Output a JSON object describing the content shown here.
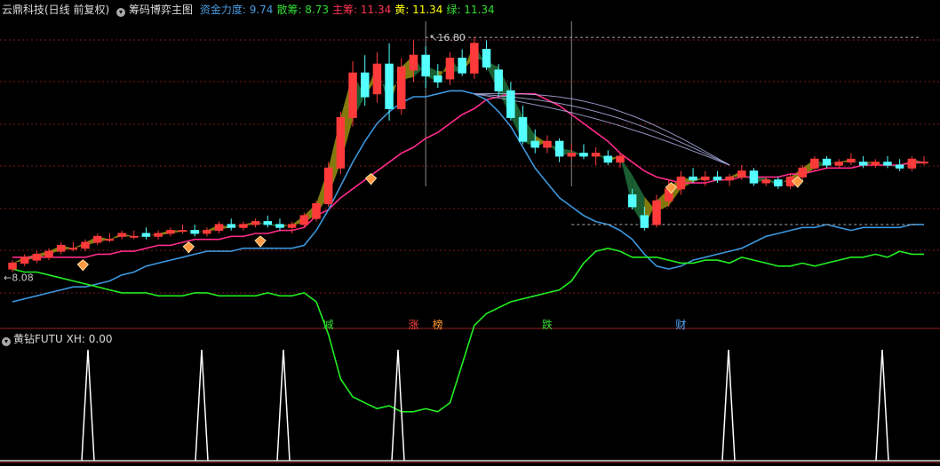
{
  "header": {
    "stock_title": "云鼎科技(日线 前复权)",
    "indicator_name": "筹码博弈主图",
    "fields": [
      {
        "label": "资金力度:",
        "value": "9.74",
        "color": "#4a9be0"
      },
      {
        "label": "散筹:",
        "value": "8.73",
        "color": "#33dd33"
      },
      {
        "label": "主筹:",
        "value": "11.34",
        "color": "#ff3355"
      },
      {
        "label": "黄:",
        "value": "11.34",
        "color": "#ffff00"
      },
      {
        "label": "绿:",
        "value": "11.34",
        "color": "#33dd33"
      }
    ]
  },
  "sub_header": {
    "indicator_name": "黄钻FUTU",
    "field_label": "XH:",
    "field_value": "0.00"
  },
  "signals": [
    {
      "text": "减",
      "color": "#33dd33"
    },
    {
      "text": "涨",
      "color": "#ff4444"
    },
    {
      "text": "榜",
      "color": "#ff9933"
    },
    {
      "text": "跌",
      "color": "#33dd33"
    },
    {
      "text": "财",
      "color": "#55aaff"
    }
  ],
  "chart_data": {
    "type": "line",
    "max_label": "16.80",
    "min_label": "8.08",
    "price_range": [
      7.6,
      17.4
    ],
    "n_bars": 76,
    "candles": [
      [
        9.0,
        9.3,
        8.9,
        9.2
      ],
      [
        9.2,
        9.5,
        9.1,
        9.4
      ],
      [
        9.3,
        9.6,
        9.2,
        9.5
      ],
      [
        9.4,
        9.7,
        9.3,
        9.6
      ],
      [
        9.6,
        9.9,
        9.5,
        9.8
      ],
      [
        9.7,
        9.9,
        9.6,
        9.7
      ],
      [
        9.7,
        10.0,
        9.6,
        9.9
      ],
      [
        9.9,
        10.2,
        9.8,
        10.1
      ],
      [
        10.0,
        10.2,
        9.9,
        10.0
      ],
      [
        10.1,
        10.3,
        10.0,
        10.2
      ],
      [
        10.1,
        10.3,
        10.0,
        10.1
      ],
      [
        10.2,
        10.4,
        10.0,
        10.1
      ],
      [
        10.1,
        10.3,
        10.0,
        10.2
      ],
      [
        10.2,
        10.4,
        10.1,
        10.3
      ],
      [
        10.3,
        10.5,
        10.2,
        10.3
      ],
      [
        10.3,
        10.5,
        10.1,
        10.2
      ],
      [
        10.2,
        10.4,
        10.1,
        10.3
      ],
      [
        10.3,
        10.6,
        10.2,
        10.5
      ],
      [
        10.5,
        10.7,
        10.3,
        10.4
      ],
      [
        10.4,
        10.6,
        10.3,
        10.5
      ],
      [
        10.5,
        10.7,
        10.4,
        10.6
      ],
      [
        10.6,
        10.8,
        10.4,
        10.5
      ],
      [
        10.5,
        10.7,
        10.3,
        10.4
      ],
      [
        10.4,
        10.6,
        10.2,
        10.5
      ],
      [
        10.5,
        10.9,
        10.4,
        10.8
      ],
      [
        10.7,
        11.3,
        10.6,
        11.2
      ],
      [
        11.2,
        12.6,
        11.1,
        12.4
      ],
      [
        12.4,
        14.3,
        12.2,
        14.1
      ],
      [
        14.1,
        16.0,
        13.8,
        15.6
      ],
      [
        15.6,
        16.2,
        14.5,
        14.8
      ],
      [
        14.9,
        16.3,
        14.6,
        15.9
      ],
      [
        15.9,
        16.6,
        14.0,
        14.4
      ],
      [
        14.4,
        16.1,
        14.2,
        15.8
      ],
      [
        15.7,
        16.7,
        15.3,
        16.2
      ],
      [
        16.2,
        16.5,
        15.1,
        15.5
      ],
      [
        15.5,
        15.9,
        15.1,
        15.3
      ],
      [
        15.4,
        16.3,
        15.2,
        16.1
      ],
      [
        16.1,
        16.4,
        15.5,
        15.6
      ],
      [
        15.6,
        16.8,
        15.4,
        16.6
      ],
      [
        16.4,
        16.7,
        15.7,
        15.8
      ],
      [
        15.7,
        15.9,
        14.8,
        15.0
      ],
      [
        15.0,
        15.3,
        14.0,
        14.1
      ],
      [
        14.1,
        14.5,
        13.2,
        13.3
      ],
      [
        13.3,
        13.7,
        12.9,
        13.1
      ],
      [
        13.1,
        13.5,
        12.9,
        13.3
      ],
      [
        13.3,
        13.4,
        12.6,
        12.8
      ],
      [
        12.8,
        13.2,
        12.7,
        12.9
      ],
      [
        12.9,
        13.2,
        12.7,
        12.8
      ],
      [
        12.8,
        13.1,
        12.5,
        12.9
      ],
      [
        12.8,
        13.0,
        12.5,
        12.6
      ],
      [
        12.6,
        12.9,
        12.4,
        12.8
      ],
      [
        11.5,
        11.7,
        11.0,
        11.1
      ],
      [
        10.8,
        11.1,
        10.3,
        10.4
      ],
      [
        10.5,
        11.5,
        10.4,
        11.3
      ],
      [
        11.3,
        12.0,
        11.1,
        11.7
      ],
      [
        11.7,
        12.3,
        11.5,
        12.1
      ],
      [
        12.1,
        12.4,
        11.9,
        12.0
      ],
      [
        12.0,
        12.3,
        11.8,
        12.1
      ],
      [
        12.1,
        12.3,
        11.9,
        12.0
      ],
      [
        12.0,
        12.2,
        11.8,
        12.1
      ],
      [
        12.1,
        12.5,
        12.0,
        12.3
      ],
      [
        12.3,
        12.4,
        11.8,
        11.9
      ],
      [
        11.9,
        12.1,
        11.8,
        12.0
      ],
      [
        12.0,
        12.1,
        11.7,
        11.8
      ],
      [
        11.8,
        12.2,
        11.7,
        12.1
      ],
      [
        12.1,
        12.5,
        12.0,
        12.4
      ],
      [
        12.4,
        12.8,
        12.3,
        12.7
      ],
      [
        12.7,
        12.8,
        12.4,
        12.5
      ],
      [
        12.5,
        12.7,
        12.4,
        12.6
      ],
      [
        12.6,
        12.9,
        12.5,
        12.7
      ],
      [
        12.6,
        12.8,
        12.4,
        12.5
      ],
      [
        12.5,
        12.7,
        12.4,
        12.6
      ],
      [
        12.6,
        12.8,
        12.4,
        12.5
      ],
      [
        12.5,
        12.7,
        12.3,
        12.4
      ],
      [
        12.4,
        12.8,
        12.3,
        12.7
      ],
      [
        12.6,
        12.8,
        12.5,
        12.6
      ]
    ],
    "series": [
      {
        "color": "#ff2a8a",
        "values": [
          9.4,
          9.4,
          9.4,
          9.4,
          9.4,
          9.4,
          9.4,
          9.5,
          9.5,
          9.6,
          9.6,
          9.7,
          9.8,
          9.8,
          9.9,
          10.0,
          10.0,
          10.0,
          10.1,
          10.1,
          10.2,
          10.2,
          10.3,
          10.3,
          10.4,
          10.8,
          11.0,
          11.4,
          11.7,
          12.0,
          12.3,
          12.6,
          12.9,
          13.1,
          13.4,
          13.6,
          13.9,
          14.2,
          14.4,
          14.7,
          14.8,
          14.9,
          14.9,
          14.9,
          14.7,
          14.5,
          14.2,
          13.9,
          13.6,
          13.3,
          12.9,
          12.6,
          12.3,
          12.1,
          12.0,
          11.9,
          11.9,
          11.9,
          12.0,
          12.0,
          12.1,
          12.1,
          12.1,
          12.1,
          12.2,
          12.2,
          12.3,
          12.4,
          12.4,
          12.4,
          12.5,
          12.5,
          12.5,
          12.5,
          12.6,
          12.6
        ]
      },
      {
        "color": "#3c96dc",
        "values": [
          7.9,
          8.0,
          8.1,
          8.2,
          8.3,
          8.4,
          8.4,
          8.5,
          8.6,
          8.8,
          8.9,
          9.1,
          9.2,
          9.3,
          9.4,
          9.5,
          9.6,
          9.6,
          9.6,
          9.7,
          9.7,
          9.7,
          9.7,
          9.7,
          9.8,
          10.3,
          11.0,
          11.8,
          12.6,
          13.3,
          13.9,
          14.3,
          14.6,
          14.8,
          14.8,
          14.9,
          15.0,
          15.0,
          14.9,
          14.7,
          14.3,
          13.8,
          13.1,
          12.4,
          11.9,
          11.4,
          11.1,
          10.8,
          10.6,
          10.5,
          10.3,
          10.0,
          9.5,
          9.1,
          9.0,
          9.1,
          9.3,
          9.4,
          9.5,
          9.6,
          9.7,
          9.9,
          10.1,
          10.2,
          10.3,
          10.4,
          10.4,
          10.5,
          10.4,
          10.3,
          10.4,
          10.4,
          10.4,
          10.4,
          10.5,
          10.5
        ]
      },
      {
        "color": "#22ee22",
        "values": [
          9.0,
          8.9,
          8.9,
          8.8,
          8.7,
          8.6,
          8.5,
          8.4,
          8.3,
          8.2,
          8.2,
          8.2,
          8.1,
          8.1,
          8.1,
          8.2,
          8.2,
          8.1,
          8.1,
          8.1,
          8.1,
          8.2,
          8.1,
          8.1,
          8.2,
          7.9,
          6.8,
          5.3,
          4.7,
          4.5,
          4.3,
          4.4,
          4.2,
          4.2,
          4.3,
          4.2,
          4.5,
          5.8,
          7.1,
          7.5,
          7.7,
          7.9,
          8.0,
          8.1,
          8.2,
          8.3,
          8.6,
          9.2,
          9.6,
          9.7,
          9.6,
          9.4,
          9.4,
          9.4,
          9.3,
          9.2,
          9.2,
          9.3,
          9.3,
          9.2,
          9.4,
          9.3,
          9.2,
          9.1,
          9.1,
          9.2,
          9.1,
          9.2,
          9.3,
          9.4,
          9.4,
          9.5,
          9.4,
          9.6,
          9.5,
          9.5
        ]
      }
    ],
    "diamonds_at": [
      6,
      22,
      30,
      47,
      79,
      94
    ],
    "xh_spikes_at": [
      7,
      16,
      23,
      32,
      59,
      71
    ],
    "signal_positions": [
      26,
      33,
      35,
      44,
      55
    ],
    "vertical_markers": [
      34,
      46
    ]
  }
}
